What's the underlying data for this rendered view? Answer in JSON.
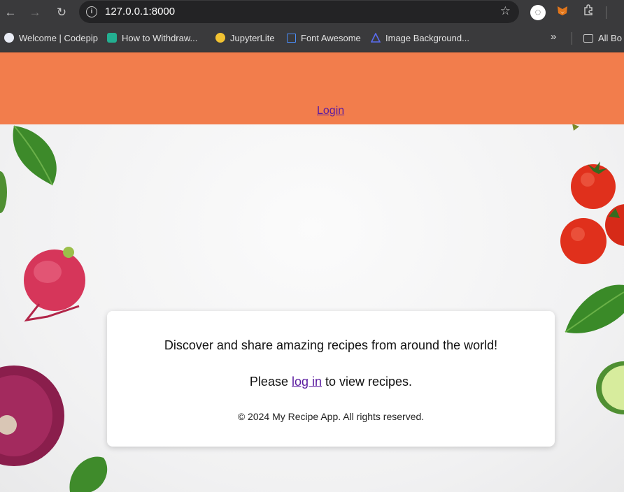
{
  "browser": {
    "url": "127.0.0.1:8000",
    "bookmarks": [
      {
        "label": "Welcome | Codepip",
        "icon": "codepip-icon",
        "color": "#3d5a9e"
      },
      {
        "label": "How to Withdraw...",
        "icon": "kucoin-icon",
        "color": "#23af91"
      },
      {
        "label": "JupyterLite",
        "icon": "jupyter-icon",
        "color": "#f1c232"
      },
      {
        "label": "Font Awesome",
        "icon": "flag-icon",
        "color": "#4a8df8"
      },
      {
        "label": "Image Background...",
        "icon": "triangle-icon",
        "color": "#5a6cf0"
      }
    ],
    "more_label": "»",
    "all_bookmarks_label": "All Bo"
  },
  "header": {
    "login_label": "Login",
    "background_color": "#f27d4c"
  },
  "card": {
    "tagline": "Discover and share amazing recipes from around the world!",
    "prompt_prefix": "Please ",
    "prompt_link": "log in",
    "prompt_suffix": " to view recipes.",
    "footer": "© 2024 My Recipe App. All rights reserved."
  }
}
